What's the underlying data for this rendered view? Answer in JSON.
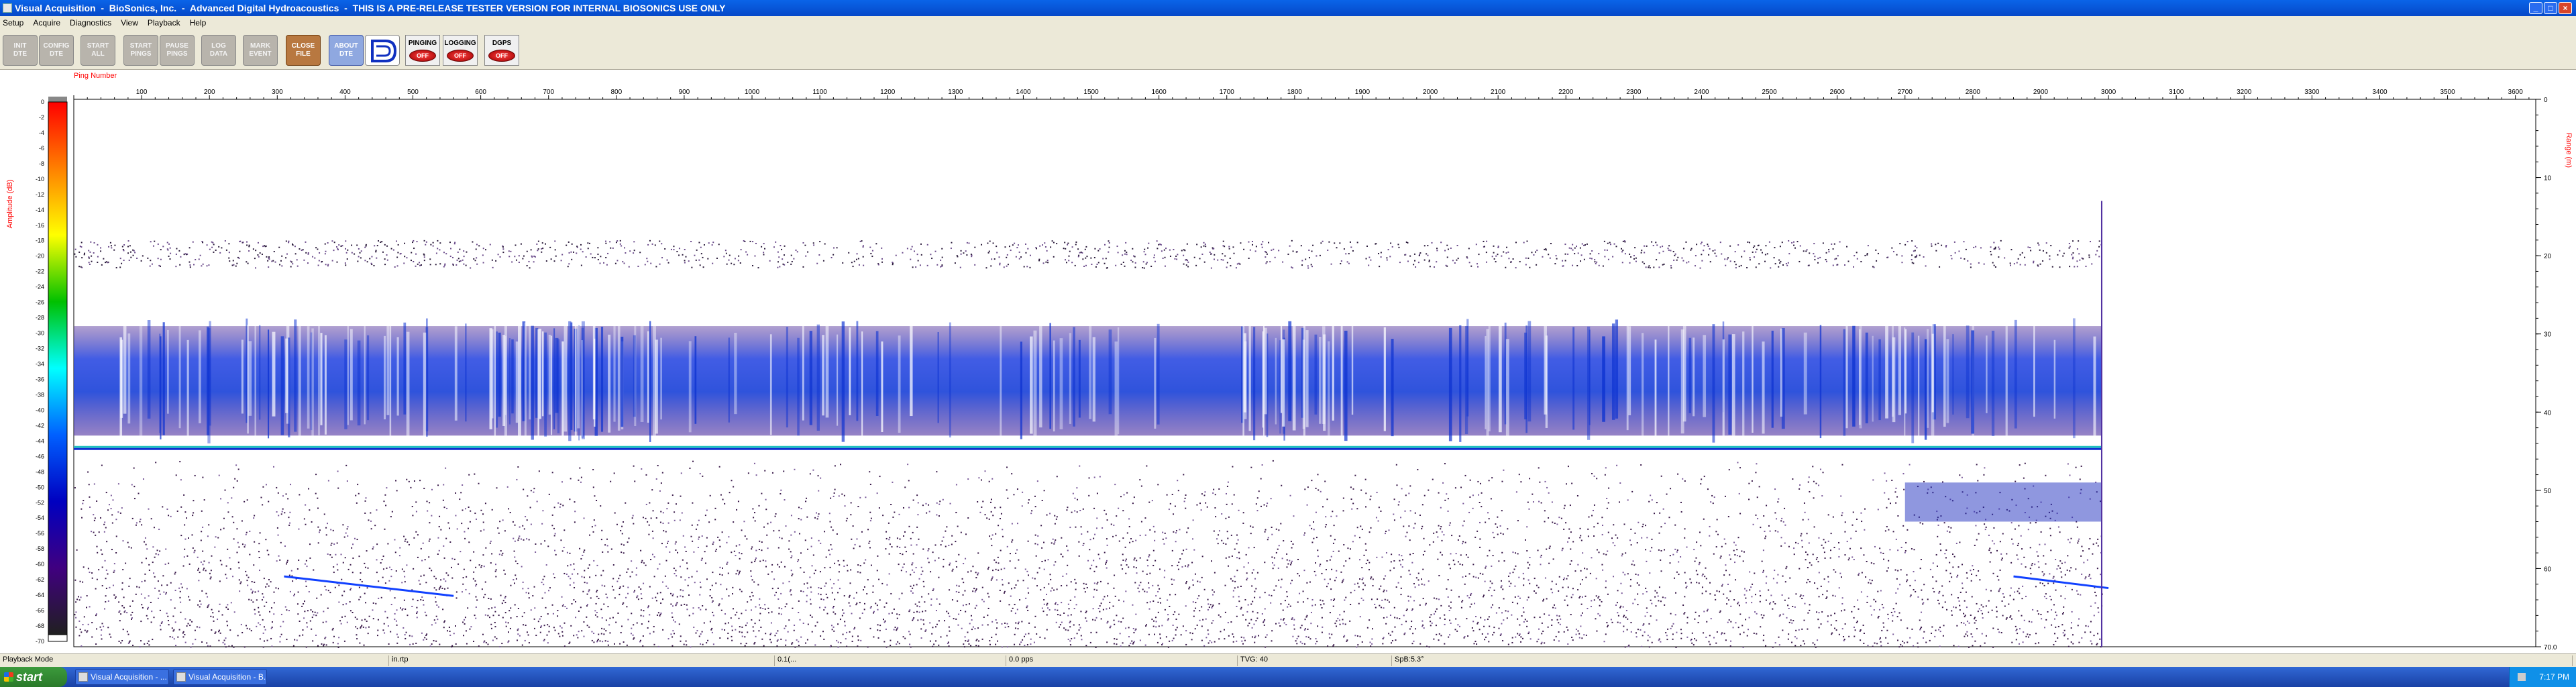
{
  "window": {
    "title": "Visual Acquisition  -  BioSonics, Inc.  -  Advanced Digital Hydroacoustics  -  THIS IS A PRE-RELEASE TESTER VERSION FOR INTERNAL BIOSONICS USE ONLY",
    "minimize": "_",
    "maximize": "□",
    "close": "×"
  },
  "menu": [
    "Setup",
    "Acquire",
    "Diagnostics",
    "View",
    "Playback",
    "Help"
  ],
  "toolbar": {
    "buttons": [
      {
        "name": "init-dte-button",
        "line1": "INIT",
        "line2": "DTE",
        "style": "gray"
      },
      {
        "name": "config-dte-button",
        "line1": "CONFIG",
        "line2": "DTE",
        "style": "gray"
      },
      {
        "name": "start-all-button",
        "line1": "START",
        "line2": "ALL",
        "style": "gray"
      },
      {
        "name": "start-pings-button",
        "line1": "START",
        "line2": "PINGS",
        "style": "gray"
      },
      {
        "name": "pause-pings-button",
        "line1": "PAUSE",
        "line2": "PINGS",
        "style": "gray"
      },
      {
        "name": "log-data-button",
        "line1": "LOG",
        "line2": "DATA",
        "style": "gray"
      },
      {
        "name": "mark-event-button",
        "line1": "MARK",
        "line2": "EVENT",
        "style": "gray"
      },
      {
        "name": "close-file-button",
        "line1": "CLOSE",
        "line2": "FILE",
        "style": "orange"
      },
      {
        "name": "about-dte-button",
        "line1": "ABOUT",
        "line2": "DTE",
        "style": "blue"
      }
    ],
    "indicators": [
      {
        "name": "pinging-indicator",
        "label": "PINGING",
        "state": "OFF"
      },
      {
        "name": "logging-indicator",
        "label": "LOGGING",
        "state": "OFF"
      },
      {
        "name": "dgps-indicator",
        "label": "DGPS",
        "state": "OFF"
      }
    ]
  },
  "echogram": {
    "x_title": "Ping Number",
    "amp_title": "Amplitude (dB)",
    "range_title": "Range (m)",
    "ping_ticks": [
      100,
      200,
      300,
      400,
      500,
      600,
      700,
      800,
      900,
      1000,
      1100,
      1200,
      1300,
      1400,
      1500,
      1600,
      1700,
      1800,
      1900,
      2000,
      2100,
      2200,
      2300,
      2400,
      2500,
      2600,
      2700,
      2800,
      2900,
      3000,
      3100,
      3200,
      3300,
      3400,
      3500,
      3600
    ],
    "ping_max": 3630,
    "pings_recorded": 2990,
    "amp_ticks": [
      0,
      -2,
      -4,
      -6,
      -8,
      -10,
      -12,
      -14,
      -16,
      -18,
      -20,
      -22,
      -24,
      -26,
      -28,
      -30,
      -32,
      -34,
      -36,
      -38,
      -40,
      -42,
      -44,
      -46,
      -48,
      -50,
      -52,
      -54,
      -56,
      -58,
      -60,
      -62,
      -64,
      -66,
      -68,
      -70
    ],
    "range_ticks": [
      "0",
      "10",
      "20",
      "30",
      "40",
      "50",
      "60",
      "70.0"
    ],
    "range_max": 70,
    "bottom_depth_m": 44.5,
    "colors": {
      "scale": [
        "#ff0000",
        "#ff8000",
        "#ffff00",
        "#00c000",
        "#00ffff",
        "#0060ff",
        "#0000c0",
        "#400080",
        "#202020"
      ],
      "axis_title": "#ff0000"
    }
  },
  "status": {
    "mode": "Playback Mode",
    "field2": "in.rtp",
    "field3": "0.1(...",
    "field4": "0.0 pps",
    "field5": "TVG: 40",
    "field6": "SpB:5.3°"
  },
  "taskbar": {
    "start": "start",
    "tasks": [
      {
        "label": "Visual Acquisition - ..."
      },
      {
        "label": "Visual Acquisition - B..."
      }
    ],
    "clock": "7:17 PM"
  }
}
